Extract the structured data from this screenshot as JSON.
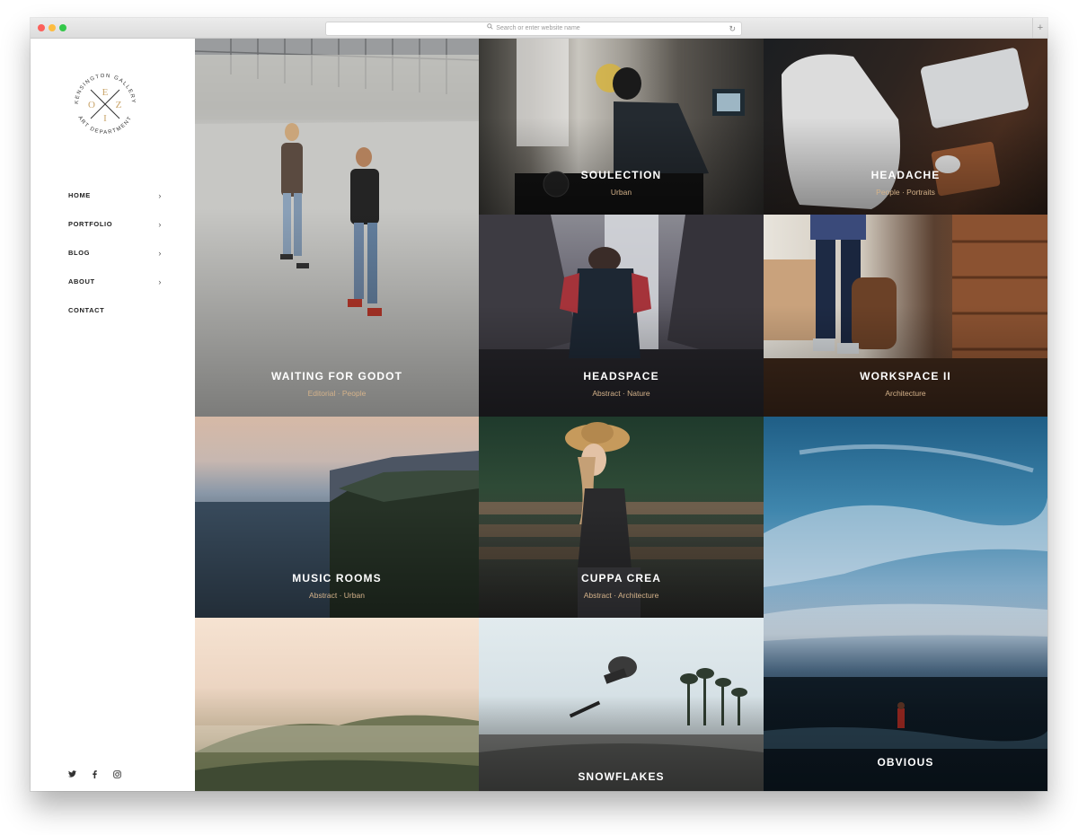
{
  "browser": {
    "url_placeholder": "Search or enter website name"
  },
  "logo": {
    "top_text": "KENSINGTON GALLERY",
    "bottom_text": "ART DEPARTMENT",
    "letters": [
      "O",
      "E",
      "Z",
      "I"
    ],
    "accent_color": "#c9a46a"
  },
  "nav": {
    "items": [
      {
        "label": "HOME",
        "has_submenu": true
      },
      {
        "label": "PORTFOLIO",
        "has_submenu": true
      },
      {
        "label": "BLOG",
        "has_submenu": true
      },
      {
        "label": "ABOUT",
        "has_submenu": true
      },
      {
        "label": "CONTACT",
        "has_submenu": false
      }
    ],
    "chevron": "›"
  },
  "social": {
    "icons": [
      "twitter-icon",
      "facebook-icon",
      "instagram-icon"
    ]
  },
  "portfolio": {
    "tiles": [
      {
        "title": "WAITING FOR GODOT",
        "tags": "Editorial · People"
      },
      {
        "title": "SOULECTION",
        "tags": "Urban"
      },
      {
        "title": "HEADACHE",
        "tags": "People · Portraits"
      },
      {
        "title": "HEADSPACE",
        "tags": "Abstract · Nature"
      },
      {
        "title": "WORKSPACE II",
        "tags": "Architecture"
      },
      {
        "title": "MUSIC ROOMS",
        "tags": "Abstract · Urban"
      },
      {
        "title": "CUPPA CREA",
        "tags": "Abstract · Architecture"
      },
      {
        "title": "OBVIOUS",
        "tags": ""
      },
      {
        "title": "",
        "tags": ""
      },
      {
        "title": "SNOWFLAKES",
        "tags": ""
      }
    ],
    "tag_color": "#d4b28a"
  }
}
